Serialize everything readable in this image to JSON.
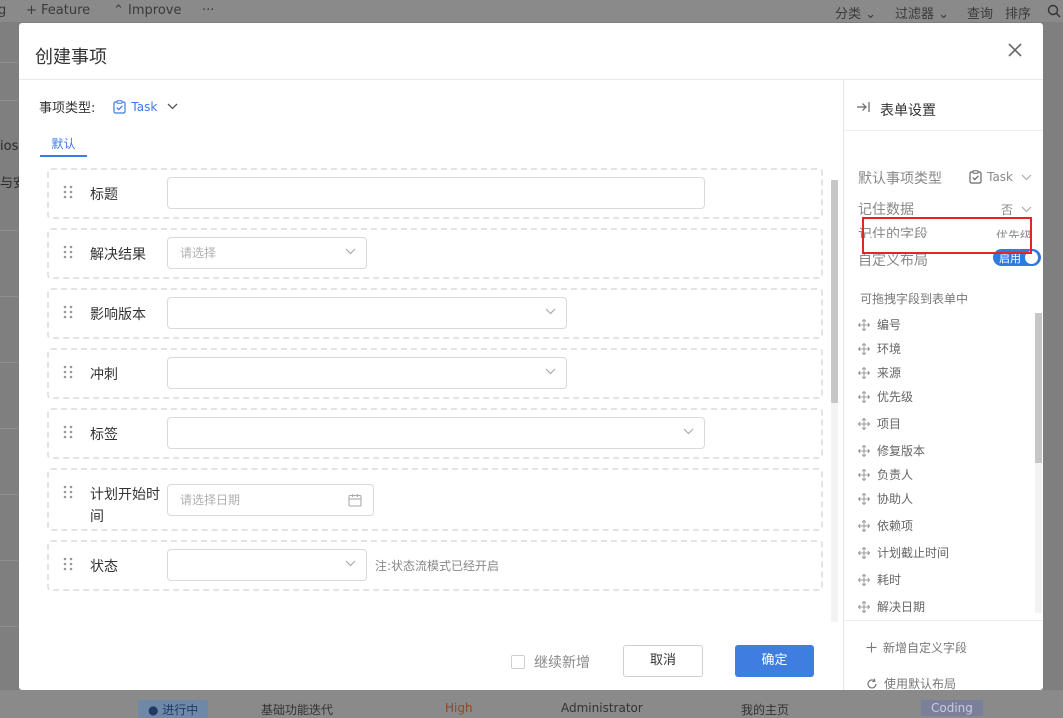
{
  "background": {
    "toolbar": {
      "feature_label": "+ Feature",
      "improve_label": "⌃ Improve",
      "more_label": "···",
      "category_label": "分类 ⌄",
      "filter_label": "过滤器 ⌄",
      "query_label": "查询",
      "sort_label": "排序"
    },
    "left_texts": [
      "ios",
      "与安"
    ],
    "bottom_row": {
      "status": "● 进行中",
      "sprint": "基础功能迭代",
      "priority": "High",
      "assignee": "Administrator",
      "home": "我的主页",
      "tag": "Coding"
    }
  },
  "modal": {
    "title": "创建事项",
    "type_label": "事项类型:",
    "type_value": "Task",
    "tab_default": "默认",
    "fields": [
      {
        "label": "标题",
        "kind": "text",
        "placeholder": ""
      },
      {
        "label": "解决结果",
        "kind": "select",
        "placeholder": "请选择"
      },
      {
        "label": "影响版本",
        "kind": "select",
        "placeholder": ""
      },
      {
        "label": "冲刺",
        "kind": "select",
        "placeholder": ""
      },
      {
        "label": "标签",
        "kind": "select",
        "placeholder": ""
      },
      {
        "label": "计划开始时间",
        "kind": "date",
        "placeholder": "请选择日期"
      },
      {
        "label": "状态",
        "kind": "select",
        "placeholder": "",
        "hint": "注:状态流模式已经开启"
      }
    ],
    "footer": {
      "continue_label": "继续新增",
      "cancel_label": "取消",
      "ok_label": "确定"
    }
  },
  "settings_panel": {
    "title": "表单设置",
    "default_type_label": "默认事项类型",
    "default_type_value": "Task",
    "remember_data_label": "记住数据",
    "remember_data_value": "否",
    "remembered_fields_label": "记住的字段",
    "remembered_fields_value": "优先级",
    "custom_layout_label": "自定义布局",
    "custom_layout_toggle": "启用",
    "custom_layout_enabled": true,
    "drag_hint": "可拖拽字段到表单中",
    "drag_fields": [
      "编号",
      "环境",
      "来源",
      "优先级",
      "项目",
      "修复版本",
      "负责人",
      "协助人",
      "依赖项",
      "计划截止时间",
      "耗时",
      "解决日期"
    ],
    "add_custom_field": "新增自定义字段",
    "use_default_layout": "使用默认布局"
  },
  "colors": {
    "accent": "#3b7be8",
    "primary_button": "#3f7ee0",
    "highlight_box": "#e5261f"
  }
}
